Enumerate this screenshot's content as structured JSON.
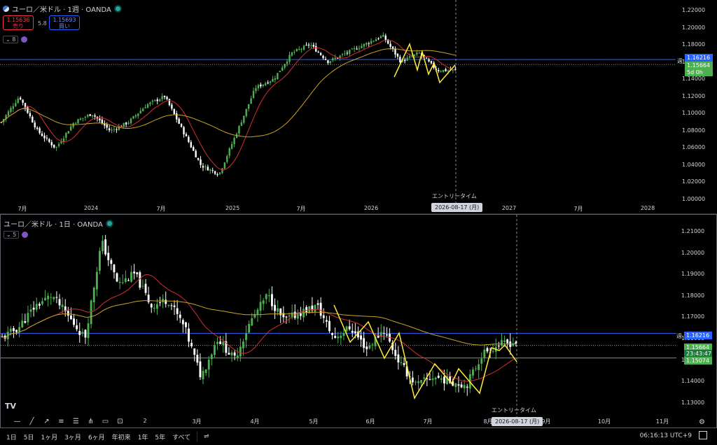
{
  "top_pane": {
    "symbol": "ユーロ／米ドル · 1週 · OANDA",
    "sell": {
      "price": "1.15636",
      "label": "売り"
    },
    "spread": "5.8",
    "buy": {
      "price": "1.15693",
      "label": "買い"
    },
    "indicator_count": "8",
    "y_ticks": [
      "1.22000",
      "1.20000",
      "1.18000",
      "1.16000",
      "1.14000",
      "1.12000",
      "1.10000",
      "1.08000",
      "1.06000",
      "1.04000",
      "1.02000",
      "1.00000"
    ],
    "x_ticks": [
      "7月",
      "2024",
      "7月",
      "2025",
      "7月",
      "2026",
      "7月",
      "2027",
      "7月",
      "2028"
    ],
    "tags": {
      "line_price": "1.16216",
      "price": "1.15664",
      "countdown": "5d 0h"
    },
    "week_label": "週",
    "entry_label": "エントリータイム",
    "entry_date": "2026-08-17 (月)"
  },
  "bottom_pane": {
    "symbol": "ユーロ／米ドル · 1日 · OANDA",
    "indicator_count": "5",
    "y_ticks": [
      "1.21000",
      "1.20000",
      "1.19000",
      "1.18000",
      "1.17000",
      "1.16000",
      "1.15000",
      "1.14000",
      "1.13000"
    ],
    "x_ticks": [
      "2",
      "3月",
      "4月",
      "5月",
      "6月",
      "7月",
      "8月",
      "9月",
      "10月",
      "11月"
    ],
    "tags": {
      "line_price": "1.16216",
      "price": "1.15664",
      "countdown": "23:43:47",
      "support": "1.15074"
    },
    "week_label": "週",
    "entry_label": "エントリータイム",
    "entry_date": "2026-08-17 (月)",
    "tv_logo": "TV"
  },
  "toolbar": {
    "timeframes": [
      "1日",
      "5日",
      "1ヶ月",
      "3ヶ月",
      "6ヶ月",
      "年初来",
      "1年",
      "5年",
      "すべて"
    ],
    "clock": "06:16:13 UTC+9"
  },
  "colors": {
    "up": "#4caf50",
    "down": "#ffffff",
    "ma_fast": "#d32f2f",
    "ma_slow": "#c9a227",
    "zigzag": "#ffeb3b",
    "level": "#2962ff",
    "support": "#4caf50"
  }
}
